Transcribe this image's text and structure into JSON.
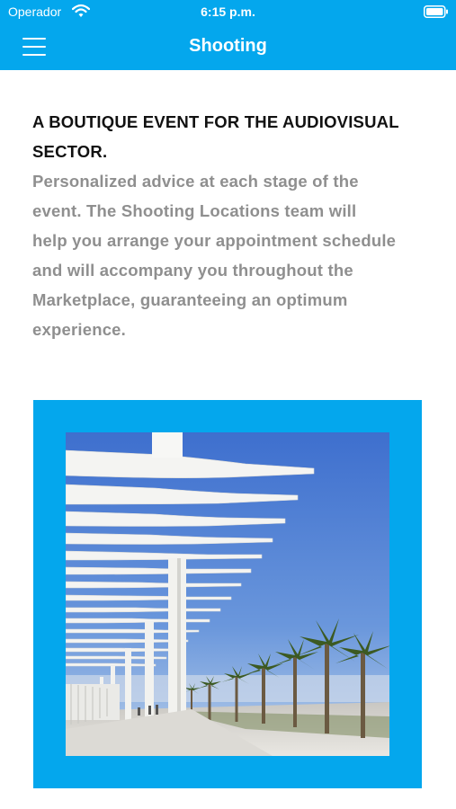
{
  "status_bar": {
    "carrier": "Operador",
    "time": "6:15 p.m."
  },
  "nav": {
    "title": "Shooting"
  },
  "intro": {
    "headline_lines": [
      "A BOUTIQUE EVENT FOR THE AUDIOVISUAL",
      "SECTOR."
    ],
    "body_lines": [
      "Personalized advice at each stage of the",
      "event. The Shooting Locations team will",
      "help you arrange your appointment schedule",
      "and will accompany you throughout the",
      "Marketplace, guaranteeing an optimum",
      "experience."
    ]
  },
  "colors": {
    "accent": "#04a7ed",
    "heading": "#111111",
    "body": "#8f8f8f"
  },
  "icons": [
    "wifi-icon",
    "battery-icon",
    "hamburger-menu-icon"
  ]
}
